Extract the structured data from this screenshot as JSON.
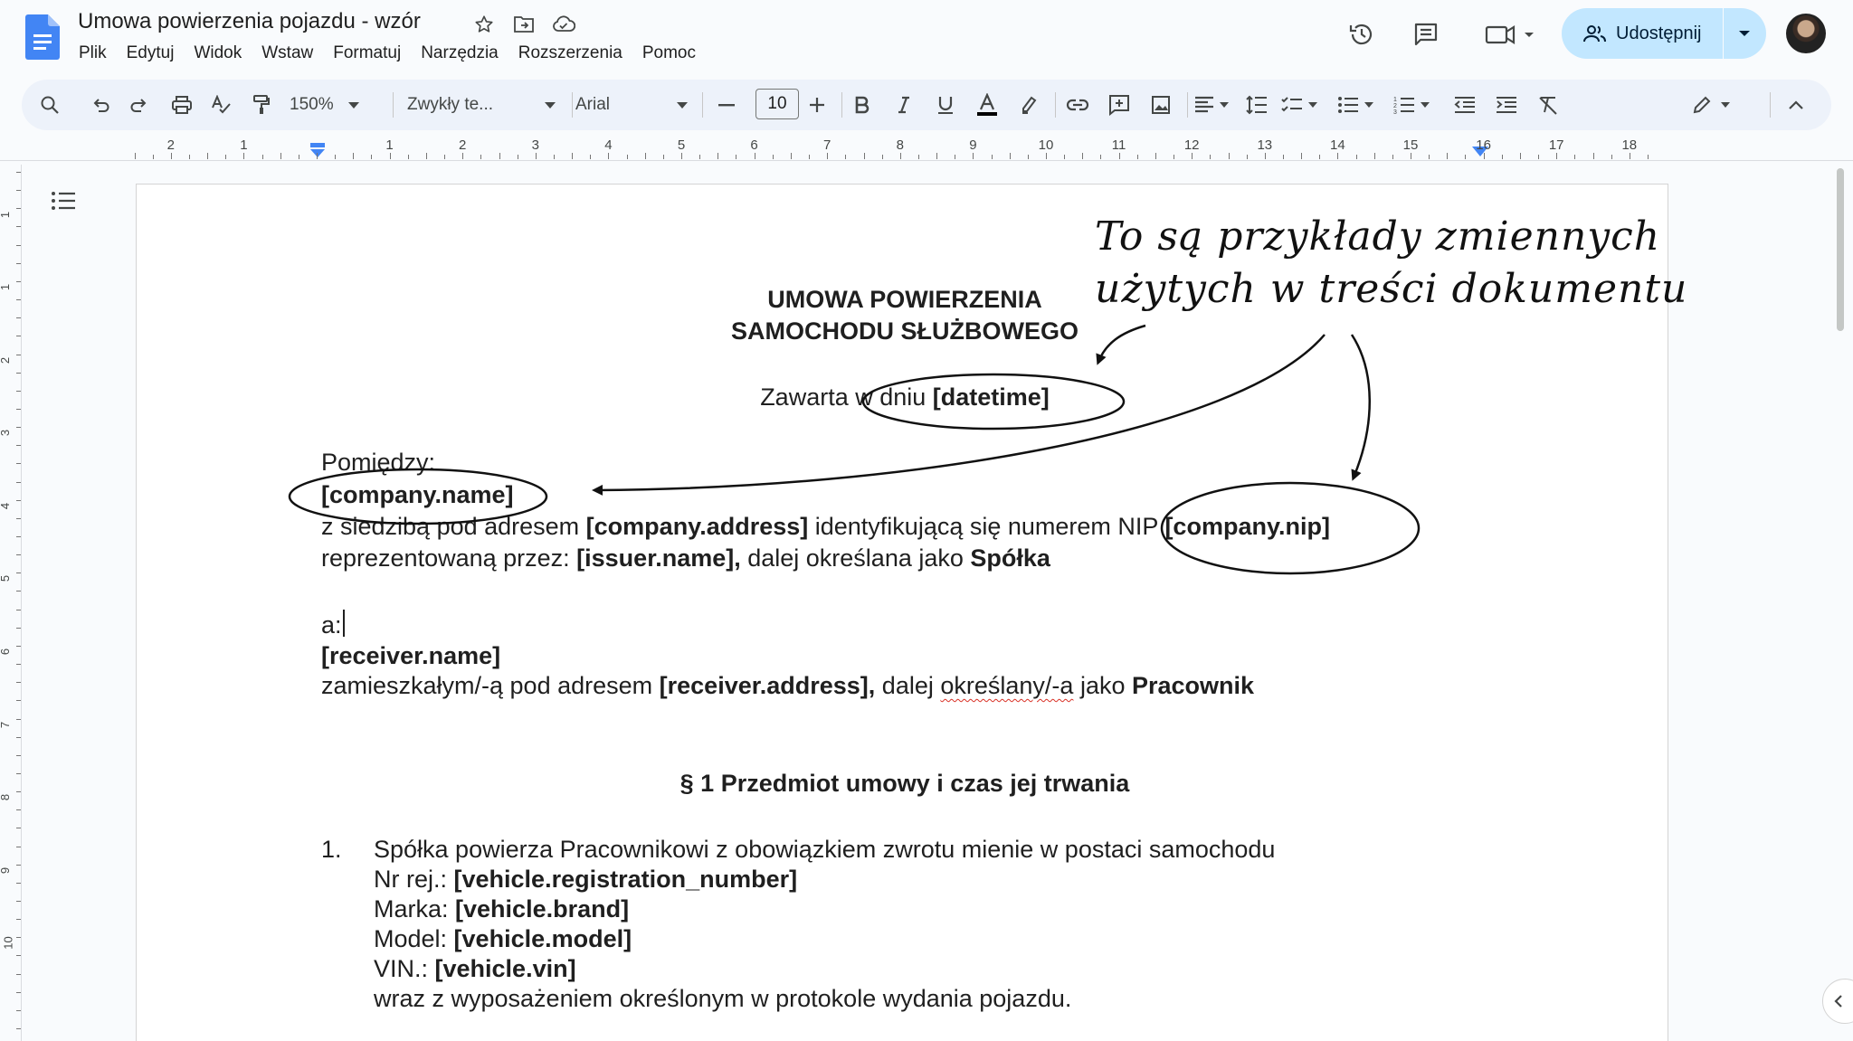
{
  "header": {
    "title": "Umowa powierzenia pojazdu - wzór",
    "menu": [
      "Plik",
      "Edytuj",
      "Widok",
      "Wstaw",
      "Formatuj",
      "Narzędzia",
      "Rozszerzenia",
      "Pomoc"
    ],
    "share_label": "Udostępnij"
  },
  "toolbar": {
    "zoom": "150%",
    "style": "Zwykły te...",
    "font": "Arial",
    "font_size": "10"
  },
  "ruler": {
    "labels": [
      "2",
      "1",
      "1",
      "2",
      "3",
      "4",
      "5",
      "6",
      "7",
      "8",
      "9",
      "10",
      "11",
      "12",
      "13",
      "14",
      "15",
      "16",
      "17",
      "18"
    ],
    "vlabels": [
      "1",
      "1",
      "2",
      "3",
      "4",
      "5",
      "6",
      "7",
      "8",
      "9",
      "10"
    ]
  },
  "document": {
    "title_line1": "UMOWA POWIERZENIA",
    "title_line2": "SAMOCHODU SŁUŻBOWEGO",
    "date_prefix": "Zawarta w dniu ",
    "date_var": "[datetime]",
    "between": "Pomiędzy:",
    "company_name": "[company.name]",
    "addr_prefix": "z siedzibą pod adresem ",
    "company_address": "[company.address]",
    "addr_mid": " identyfikującą się numerem NIP ",
    "company_nip": "[company.nip]",
    "repr_prefix": "reprezentowaną przez: ",
    "issuer_name": "[issuer.name],",
    "repr_mid": " dalej określana jako ",
    "company_role": "Spółka",
    "and": "a:",
    "receiver_name": "[receiver.name]",
    "resid_prefix": "zamieszkałym/-ą pod adresem ",
    "receiver_address": "[receiver.address],",
    "resid_mid": " dalej ",
    "resid_spell": "określany/-a",
    "resid_mid2": " jako ",
    "receiver_role": "Pracownik",
    "section1": "§ 1 Przedmiot umowy i czas jej trwania",
    "item1_num": "1.",
    "item1_text": "Spółka powierza Pracownikowi z obowiązkiem zwrotu mienie w postaci samochodu",
    "reg_label": "Nr rej.: ",
    "reg_var": "[vehicle.registration_number]",
    "brand_label": "Marka: ",
    "brand_var": "[vehicle.brand]",
    "model_label": "Model: ",
    "model_var": "[vehicle.model]",
    "vin_label": "VIN.: ",
    "vin_var": "[vehicle.vin]",
    "item1_tail": "wraz z wyposażeniem określonym w protokole wydania pojazdu."
  },
  "annotation": {
    "line1": "To są przykłady zmiennych",
    "line2": "użytych w treści dokumentu"
  },
  "colors": {
    "share_bg": "#c2e7ff",
    "toolbar_bg": "#edf2fa",
    "doc_blue": "#4285f4",
    "spell_red": "#d93025"
  }
}
